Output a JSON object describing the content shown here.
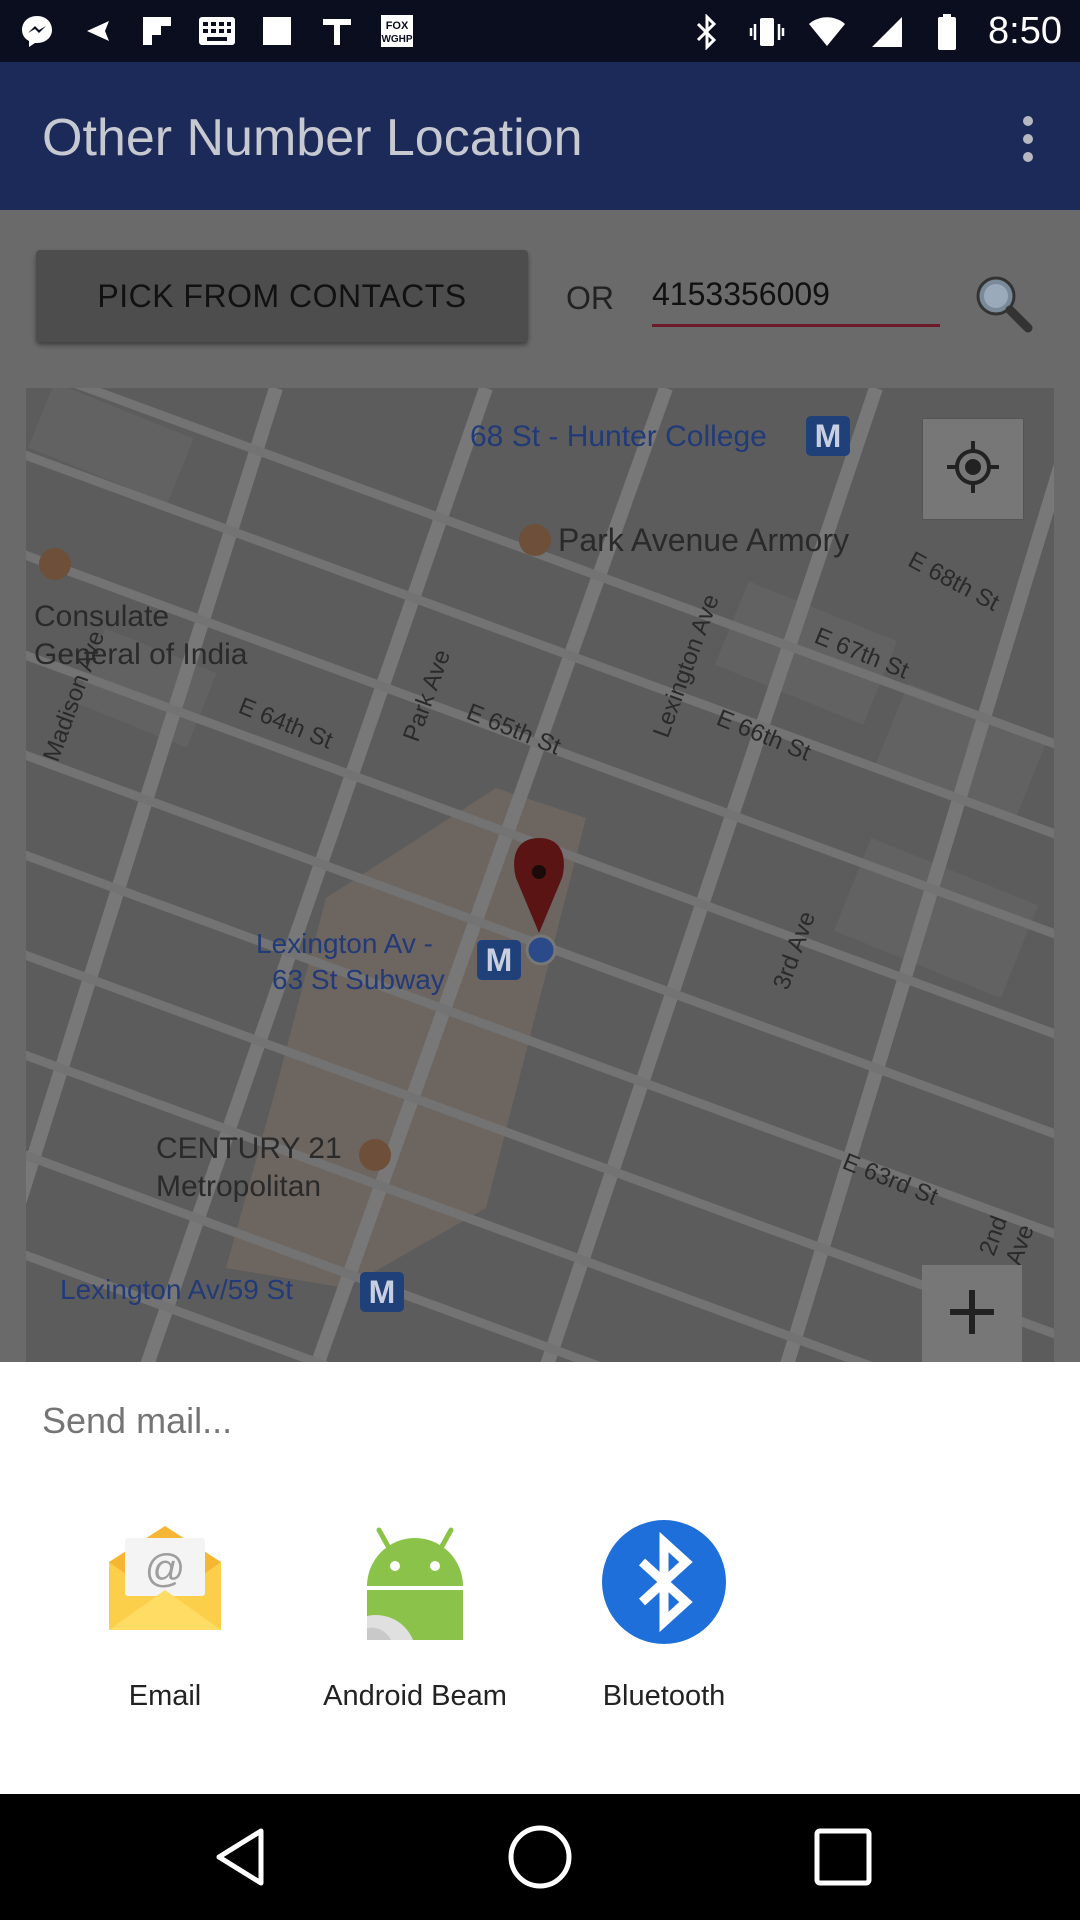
{
  "status_bar": {
    "time": "8:50",
    "left_icons": [
      "messenger-icon",
      "back-arrow-icon",
      "flipboard-icon",
      "keyboard-icon",
      "blank-icon",
      "tv-icon",
      "fox-news-icon"
    ],
    "right_icons": [
      "bluetooth-icon",
      "vibrate-icon",
      "wifi-icon",
      "signal-icon",
      "battery-icon"
    ]
  },
  "app_bar": {
    "title": "Other Number Location",
    "overflow_icon": "more-vert-icon"
  },
  "toolbar": {
    "pick_label": "PICK FROM CONTACTS",
    "or_label": "OR",
    "phone_value": "4153356009",
    "search_icon": "search-icon"
  },
  "map": {
    "labels": [
      "68 St - Hunter College",
      "Park Avenue Armory",
      "E 68th St",
      "Consulate",
      "General of India",
      "Madison Ave",
      "E 64th St",
      "Park Ave",
      "E 65th St",
      "Lexington Ave",
      "E 67th St",
      "E 66th St",
      "Lexington Av -",
      "63 St Subway",
      "3rd Ave",
      "CENTURY 21",
      "Metropolitan",
      "E 63rd St",
      "2nd Ave",
      "Lexington Av/59 St"
    ],
    "my_location_icon": "my-location-icon",
    "zoom_in_icon": "plus-icon",
    "marker_icon": "map-pin-icon",
    "metro_icon": "metro-icon"
  },
  "share_sheet": {
    "title": "Send mail...",
    "apps": [
      {
        "label": "Email",
        "icon": "email-icon"
      },
      {
        "label": "Android Beam",
        "icon": "android-icon"
      },
      {
        "label": "Bluetooth",
        "icon": "bluetooth-icon"
      }
    ]
  },
  "nav_bar": {
    "back_icon": "back-icon",
    "home_icon": "home-icon",
    "recents_icon": "recents-icon"
  }
}
